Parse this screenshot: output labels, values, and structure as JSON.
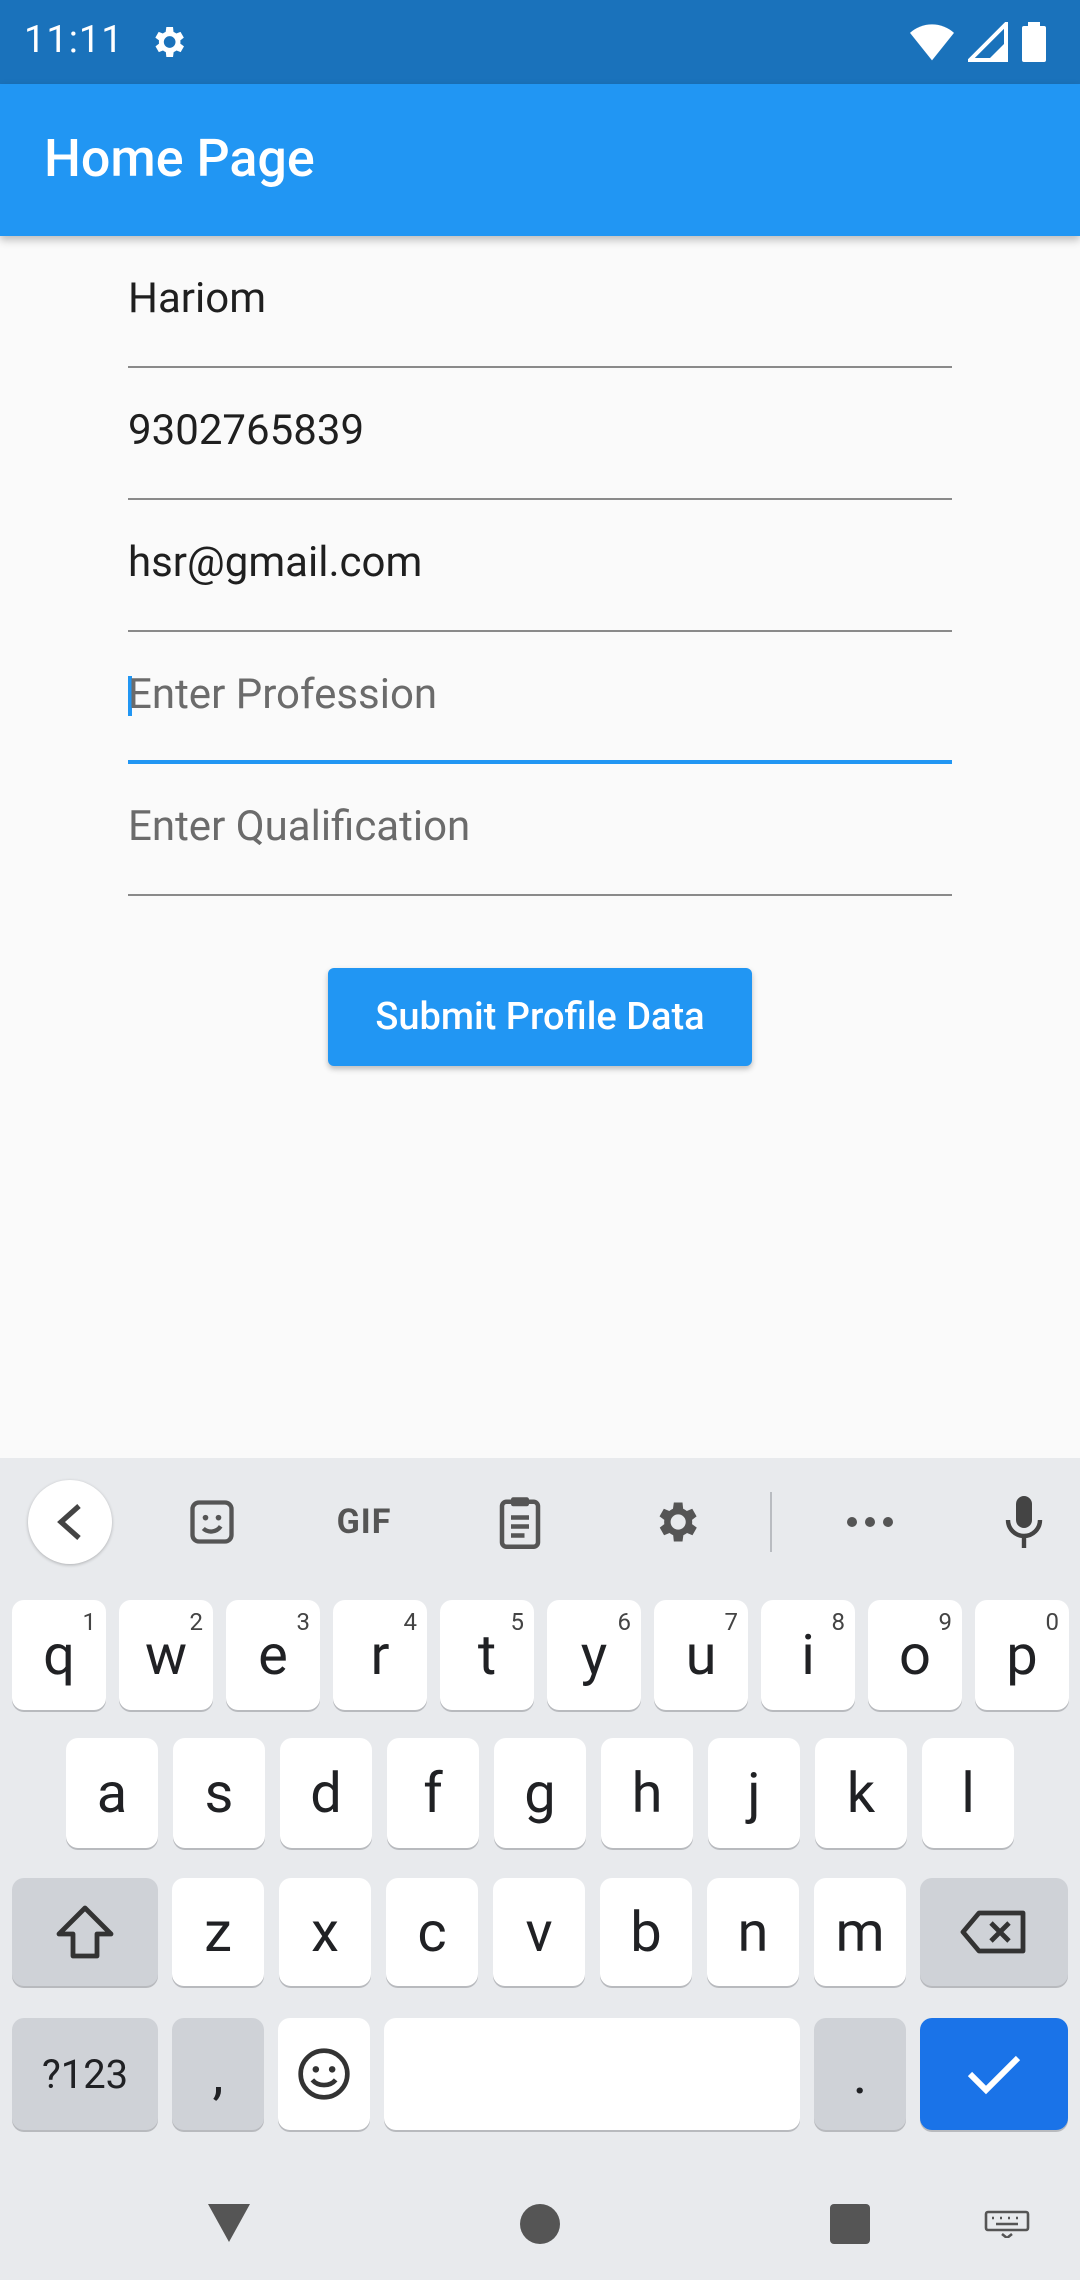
{
  "status_bar": {
    "time": "11:11"
  },
  "app_bar": {
    "title": "Home Page"
  },
  "form": {
    "name_value": "Hariom",
    "phone_value": "9302765839",
    "email_value": "hsr@gmail.com",
    "profession_placeholder": "Enter Profession",
    "qualification_placeholder": "Enter Qualification",
    "submit_label": "Submit Profile Data"
  },
  "keyboard": {
    "toolbar": {
      "gif_label": "GIF"
    },
    "row1": [
      {
        "k": "q",
        "n": "1"
      },
      {
        "k": "w",
        "n": "2"
      },
      {
        "k": "e",
        "n": "3"
      },
      {
        "k": "r",
        "n": "4"
      },
      {
        "k": "t",
        "n": "5"
      },
      {
        "k": "y",
        "n": "6"
      },
      {
        "k": "u",
        "n": "7"
      },
      {
        "k": "i",
        "n": "8"
      },
      {
        "k": "o",
        "n": "9"
      },
      {
        "k": "p",
        "n": "0"
      }
    ],
    "row2": [
      "a",
      "s",
      "d",
      "f",
      "g",
      "h",
      "j",
      "k",
      "l"
    ],
    "row3": [
      "z",
      "x",
      "c",
      "v",
      "b",
      "n",
      "m"
    ],
    "symbols_label": "?123",
    "comma_label": ",",
    "period_label": "."
  },
  "colors": {
    "accent": "#2196f3",
    "status_bar": "#1a72bb",
    "enter_key": "#1a73e8"
  }
}
